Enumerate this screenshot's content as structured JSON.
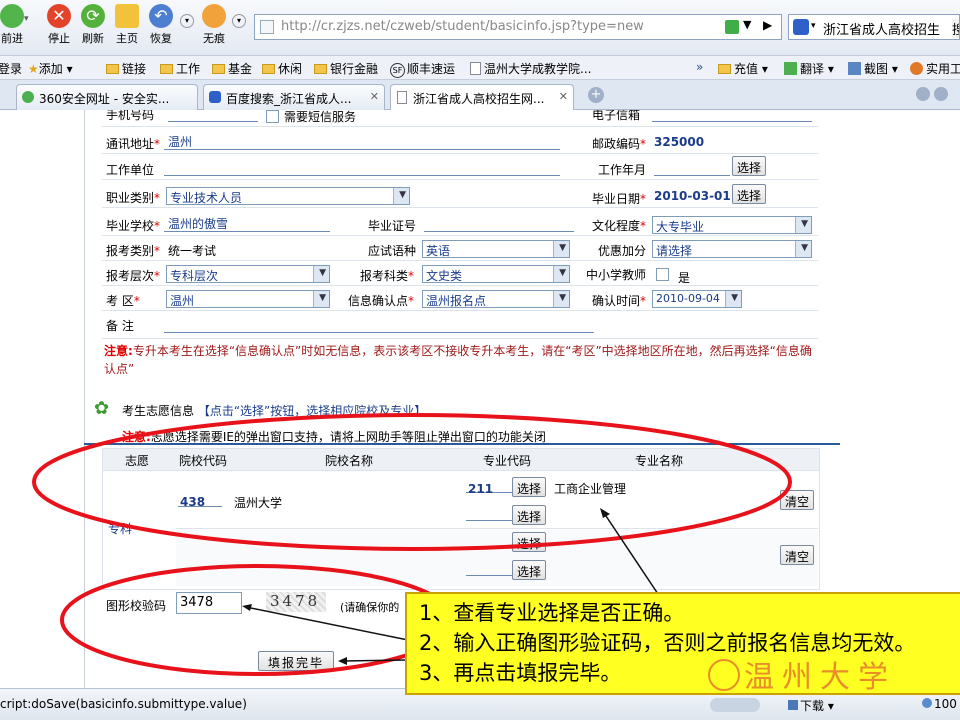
{
  "browser": {
    "nav": [
      {
        "label": "前进"
      },
      {
        "label": "停止"
      },
      {
        "label": "刷新"
      },
      {
        "label": "主页"
      },
      {
        "label": "恢复"
      },
      {
        "label": "无痕"
      }
    ],
    "url": "http://cr.zjzs.net/czweb/student/basicinfo.jsp?type=new",
    "search_text": "浙江省成人高校招生",
    "search_extra": "搜",
    "favorites": [
      "登录",
      "添加",
      "链接",
      "工作",
      "基金",
      "休闲",
      "银行金融",
      "顺丰速运",
      "温州大学成教学院...",
      "充值",
      "翻译",
      "截图",
      "实用工"
    ],
    "tabs": [
      {
        "label": "360安全网址 - 安全实..."
      },
      {
        "label": "百度搜索_浙江省成人..."
      },
      {
        "label": "浙江省成人高校招生网..."
      }
    ],
    "colors": {
      "callout": "#ffff22",
      "oval": "#e8121a",
      "arrow": "#111111"
    }
  },
  "form": {
    "top_partial_left": "手机号码",
    "sms_label": "需要短信服务",
    "top_partial_right": "电子信箱",
    "address_label": "通讯地址",
    "address_value": "温州",
    "postcode_label": "邮政编码",
    "postcode_value": "325000",
    "work_unit_label": "工作单位",
    "work_years_label": "工作年月",
    "select_btn": "选择",
    "occupation_label": "职业类别",
    "occupation_value": "专业技术人员",
    "grad_date_label": "毕业日期",
    "grad_date_value": "2010-03-01",
    "school_label": "毕业学校",
    "school_value": "温州的傲雪",
    "cert_label": "毕业证号",
    "edu_label": "文化程度",
    "edu_value": "大专毕业",
    "exam_type_label": "报考类别",
    "exam_type_value": "统一考试",
    "lang_label": "应试语种",
    "lang_value": "英语",
    "bonus_label": "优惠加分",
    "bonus_value": "请选择",
    "level_label": "报考层次",
    "level_value": "专科层次",
    "subject_label": "报考科类",
    "subject_value": "文史类",
    "teacher_label": "中小学教师",
    "teacher_value": "是",
    "district_label": "考 区",
    "district_value": "温州",
    "confirm_point_label": "信息确认点",
    "confirm_point_value": "温州报名点",
    "confirm_time_label": "确认时间",
    "confirm_time_value": "2010-09-04",
    "remark_label": "备 注",
    "note_prefix": "注意:",
    "note_text": "专升本考生在选择“信息确认点”时如无信息，表示该考区不接收专升本考生，请在“考区”中选择地区所在地，然后再选择“信息确认点”"
  },
  "wish": {
    "title": "考生志愿信息",
    "title_hint": "【点击“选择”按钮，选择相应院校及专业】",
    "note_prefix": "注意:",
    "note_text": "志愿选择需要IE的弹出窗口支持，请将上网助手等阻止弹出窗口的功能关闭",
    "headers": [
      "志愿",
      "院校代码",
      "院校名称",
      "专业代码",
      "专业名称"
    ],
    "row_label": "专科",
    "school_code": "438",
    "school_name": "温州大学",
    "major_code": "211",
    "major_name": "工商企业管理",
    "clear_btn": "清空"
  },
  "captcha": {
    "label": "图形校验码",
    "input_value": "3478",
    "image_text": "3478",
    "hint": "(请确保你的"
  },
  "submit_btn": "填报完毕",
  "status": {
    "text": "cript:doSave(basicinfo.submittype.value)",
    "download": "下载",
    "zoom": "100"
  },
  "callout": [
    "1、查看专业选择是否正确。",
    "2、输入正确图形验证码，否则之前报名信息均无效。",
    "3、再点击填报完毕。"
  ],
  "watermark": "温州大学"
}
